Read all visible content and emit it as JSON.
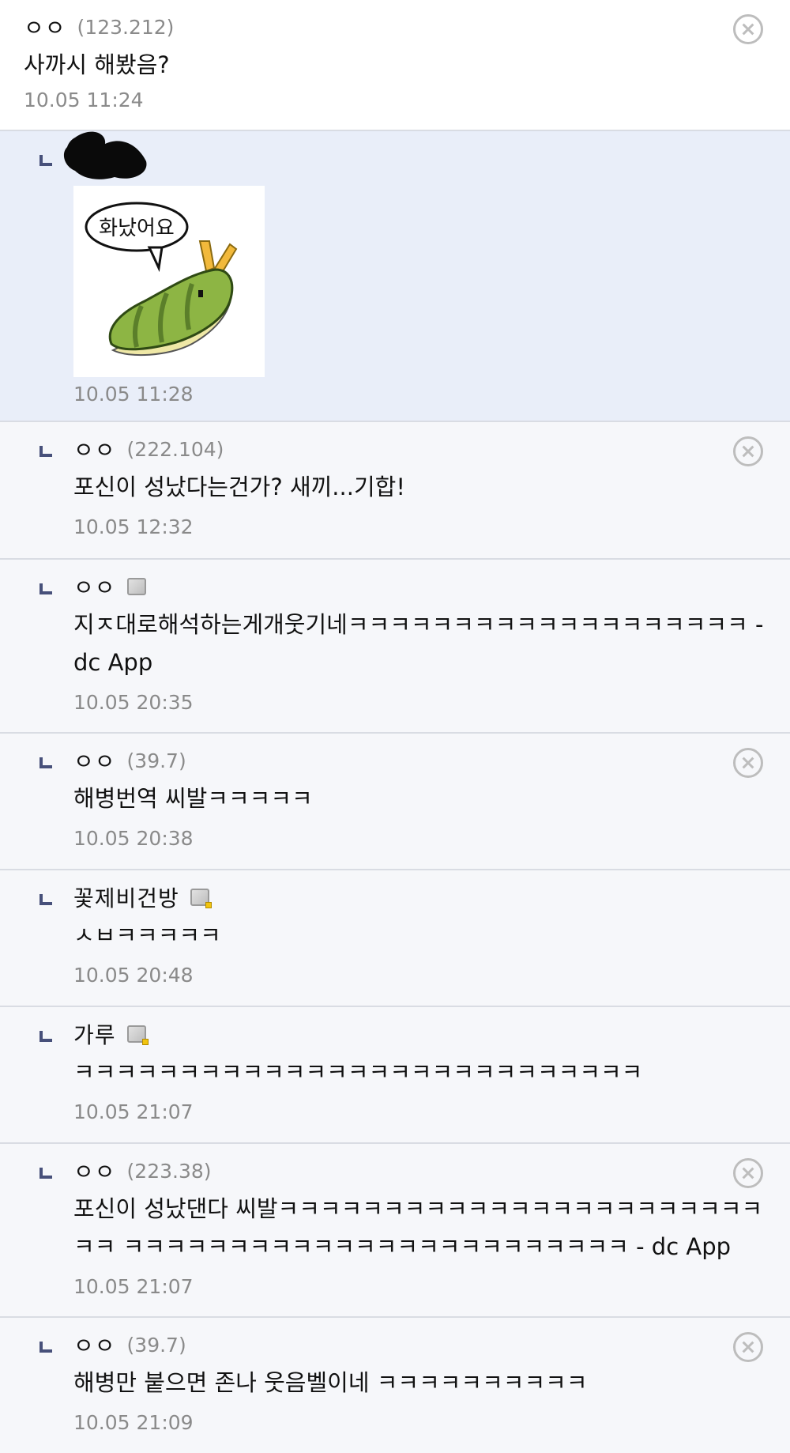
{
  "comments": [
    {
      "nick": "ㅇㅇ",
      "ip": "(123.212)",
      "text": "사까시 해봤음?",
      "date": "10.05 11:24"
    },
    {
      "date": "10.05 11:28",
      "sticker_text": "화났어요"
    },
    {
      "nick": "ㅇㅇ",
      "ip": "(222.104)",
      "text": "포신이 성났다는건가? 새끼...기합!",
      "date": "10.05 12:32"
    },
    {
      "nick": "ㅇㅇ",
      "text": "지ㅈ대로해석하는게개웃기네ㅋㅋㅋㅋㅋㅋㅋㅋㅋㅋㅋㅋㅋㅋㅋㅋㅋㅋㅋ - dc App",
      "date": "10.05 20:35"
    },
    {
      "nick": "ㅇㅇ",
      "ip": "(39.7)",
      "text": "해병번역 씨발ㅋㅋㅋㅋㅋ",
      "date": "10.05 20:38"
    },
    {
      "nick": "꽃제비건방",
      "text": "ㅅㅂㅋㅋㅋㅋㅋ",
      "date": "10.05 20:48"
    },
    {
      "nick": "가루",
      "text": "ㅋㅋㅋㅋㅋㅋㅋㅋㅋㅋㅋㅋㅋㅋㅋㅋㅋㅋㅋㅋㅋㅋㅋㅋㅋㅋㅋ",
      "date": "10.05 21:07"
    },
    {
      "nick": "ㅇㅇ",
      "ip": "(223.38)",
      "text": "포신이 성났댄다 씨발ㅋㅋㅋㅋㅋㅋㅋㅋㅋㅋㅋㅋㅋㅋㅋㅋㅋㅋㅋㅋㅋㅋㅋㅋㅋ ㅋㅋㅋㅋㅋㅋㅋㅋㅋㅋㅋㅋㅋㅋㅋㅋㅋㅋㅋㅋㅋㅋㅋㅋ - dc App",
      "date": "10.05 21:07"
    },
    {
      "nick": "ㅇㅇ",
      "ip": "(39.7)",
      "text": "해병만 붙으면 존나 웃음벨이네 ㅋㅋㅋㅋㅋㅋㅋㅋㅋㅋ",
      "date": "10.05 21:09"
    }
  ],
  "colors": {
    "accent_reply_mark": "#47507a",
    "highlight_bg": "#e9eef9",
    "reply_bg": "#f6f7fa",
    "meta_text": "#8a8a8a"
  },
  "icons": {
    "delete": "circle-x-icon",
    "gallog": "gallog-icon",
    "reply": "reply-corner-icon"
  }
}
